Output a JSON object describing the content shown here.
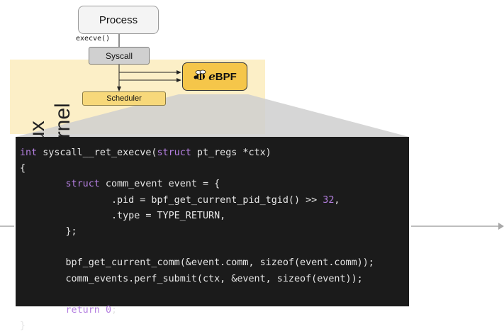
{
  "diagram": {
    "process_label": "Process",
    "execve_label": "execve()",
    "syscall_label": "Syscall",
    "scheduler_label": "Scheduler",
    "ebpf_label_e": "e",
    "ebpf_label_bpf": "BPF",
    "kernel_label_line1": "Linux",
    "kernel_label_line2": "Kernel",
    "colors": {
      "kernel_band": "#fcefc7",
      "ebpf_box": "#f5c64a",
      "scheduler_box": "#f7d87a",
      "syscall_box": "#d0d0d0",
      "code_background": "#1b1b1b",
      "code_keyword": "#b47fe0"
    }
  },
  "code": {
    "lines": [
      [
        {
          "t": "int",
          "c": "kw"
        },
        {
          "t": " syscall__ret_execve("
        },
        {
          "t": "struct",
          "c": "kw"
        },
        {
          "t": " pt_regs *ctx)"
        }
      ],
      [
        {
          "t": "{"
        }
      ],
      [
        {
          "t": "        "
        },
        {
          "t": "struct",
          "c": "kw"
        },
        {
          "t": " comm_event event = {"
        }
      ],
      [
        {
          "t": "                .pid = bpf_get_current_pid_tgid() >> "
        },
        {
          "t": "32",
          "c": "num"
        },
        {
          "t": ","
        }
      ],
      [
        {
          "t": "                .type = TYPE_RETURN,"
        }
      ],
      [
        {
          "t": "        };"
        }
      ],
      [
        {
          "t": ""
        }
      ],
      [
        {
          "t": "        bpf_get_current_comm(&event.comm, sizeof(event.comm));"
        }
      ],
      [
        {
          "t": "        comm_events.perf_submit(ctx, &event, sizeof(event));"
        }
      ],
      [
        {
          "t": ""
        }
      ],
      [
        {
          "t": "        "
        },
        {
          "t": "return",
          "c": "kw"
        },
        {
          "t": " "
        },
        {
          "t": "0",
          "c": "num"
        },
        {
          "t": ";"
        }
      ],
      [
        {
          "t": "}"
        }
      ]
    ]
  }
}
